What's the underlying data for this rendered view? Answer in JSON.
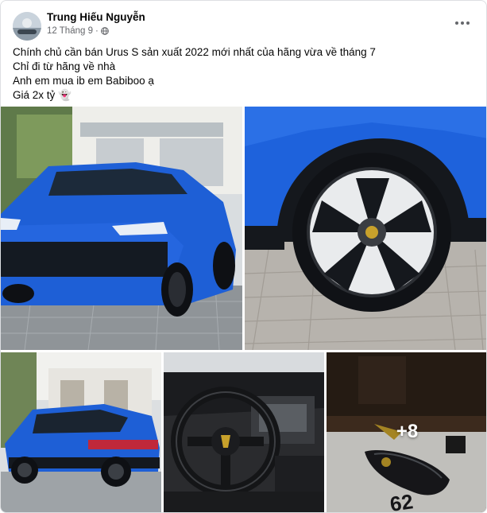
{
  "post": {
    "author": "Trung Hiếu Nguyễn",
    "date": "12 Tháng 9",
    "separator": "·",
    "audience_icon": "globe-icon",
    "more_icon": "more-horizontal-icon",
    "lines": [
      "Chính chủ cần bán Urus S sản xuất 2022 mới nhất của hãng vừa về tháng 7",
      "Chỉ đi từ hãng về nhà",
      "Anh em mua ib em Babiboo ạ",
      "Giá 2x tỷ 👻"
    ]
  },
  "photos": {
    "count": 5,
    "extra_count_label": "+8",
    "accent_blue": "#1e5fd6",
    "items": [
      {
        "name": "front-view"
      },
      {
        "name": "wheel-closeup"
      },
      {
        "name": "rear-side-view"
      },
      {
        "name": "interior-steering-wheel"
      },
      {
        "name": "key-fob"
      }
    ]
  },
  "colors": {
    "text": "#050505",
    "secondary": "#65676b",
    "border": "#dddfe2",
    "car_blue": "#1e5fd6"
  }
}
